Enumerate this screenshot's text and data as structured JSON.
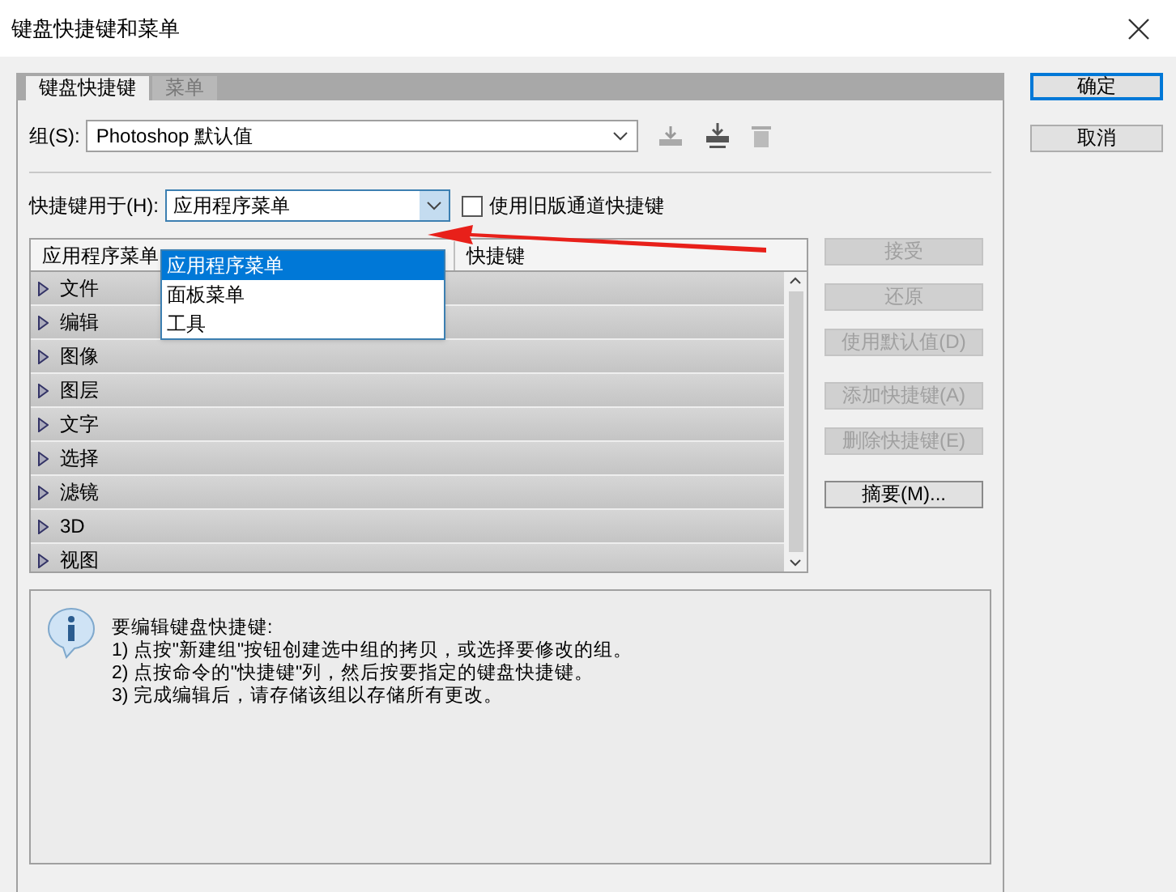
{
  "window": {
    "title": "键盘快捷键和菜单"
  },
  "tabs": [
    {
      "label": "键盘快捷键",
      "selected": true
    },
    {
      "label": "菜单",
      "selected": false
    }
  ],
  "group": {
    "label": "组(S):",
    "value": "Photoshop 默认值"
  },
  "shortcuts_for": {
    "label": "快捷键用于(H):",
    "value": "应用程序菜单",
    "expanded": true,
    "options": [
      {
        "label": "应用程序菜单",
        "selected": true
      },
      {
        "label": "面板菜单",
        "selected": false
      },
      {
        "label": "工具",
        "selected": false
      }
    ]
  },
  "legacy_checkbox": {
    "label": "使用旧版通道快捷键",
    "checked": false
  },
  "table": {
    "columns": [
      "应用程序菜单",
      "快捷键"
    ],
    "rows": [
      {
        "label": "文件",
        "expanded": false
      },
      {
        "label": "编辑",
        "expanded": false
      },
      {
        "label": "图像",
        "expanded": false
      },
      {
        "label": "图层",
        "expanded": false
      },
      {
        "label": "文字",
        "expanded": false
      },
      {
        "label": "选择",
        "expanded": false
      },
      {
        "label": "滤镜",
        "expanded": false
      },
      {
        "label": "3D",
        "expanded": false
      },
      {
        "label": "视图",
        "expanded": false
      }
    ]
  },
  "side_buttons": [
    {
      "label": "接受",
      "disabled": true
    },
    {
      "label": "还原",
      "disabled": true
    },
    {
      "label": "使用默认值(D)",
      "disabled": true
    },
    {
      "label": "添加快捷键(A)",
      "disabled": true
    },
    {
      "label": "删除快捷键(E)",
      "disabled": true
    },
    {
      "label": "摘要(M)...",
      "disabled": false
    }
  ],
  "info": [
    "要编辑键盘快捷键:",
    "1) 点按\"新建组\"按钮创建选中组的拷贝，或选择要修改的组。",
    "2) 点按命令的\"快捷键\"列，然后按要指定的键盘快捷键。",
    "3) 完成编辑后，请存储该组以存储所有更改。"
  ],
  "dialog_buttons": [
    {
      "label": "确定",
      "selected": true
    },
    {
      "label": "取消",
      "selected": false
    }
  ]
}
